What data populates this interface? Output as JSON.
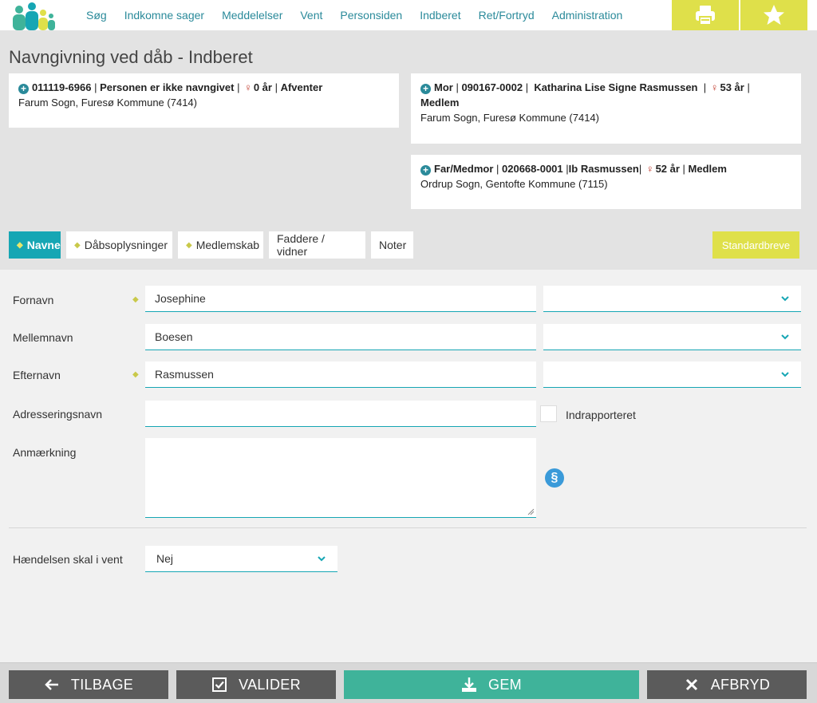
{
  "nav": {
    "items": [
      "Søg",
      "Indkomne sager",
      "Meddelelser",
      "Vent",
      "Personsiden",
      "Indberet",
      "Ret/Fortryd",
      "Administration"
    ]
  },
  "page": {
    "title": "Navngivning ved dåb - Indberet"
  },
  "child": {
    "cpr": "011119-6966",
    "status": "Personen er ikke navngivet",
    "age": "0 år",
    "state": "Afventer",
    "parish": "Farum Sogn, Furesø Kommune (7414)"
  },
  "mother": {
    "role": "Mor",
    "cpr": "090167-0002",
    "name": "Katharina Lise Signe Rasmussen",
    "age": "53 år",
    "membership": "Medlem",
    "parish": "Farum Sogn, Furesø Kommune (7414)"
  },
  "father": {
    "role": "Far/Medmor",
    "cpr": "020668-0001",
    "name": "Ib Rasmussen",
    "age": "52 år",
    "membership": "Medlem",
    "parish": "Ordrup Sogn, Gentofte Kommune (7115)"
  },
  "tabs": [
    {
      "label": "Navne",
      "dot": true,
      "active": true
    },
    {
      "label": "Dåbsoplysninger",
      "dot": true
    },
    {
      "label": "Medlemskab",
      "dot": true
    },
    {
      "label": "Faddere / vidner",
      "dot": false
    },
    {
      "label": "Noter",
      "dot": false
    }
  ],
  "standardbreve_label": "Standardbreve",
  "form": {
    "fornavn": {
      "label": "Fornavn",
      "value": "Josephine"
    },
    "mellemnavn": {
      "label": "Mellemnavn",
      "value": "Boesen"
    },
    "efternavn": {
      "label": "Efternavn",
      "value": "Rasmussen"
    },
    "adresseringsnavn": {
      "label": "Adresseringsnavn",
      "value": ""
    },
    "indrapporteret_label": "Indrapporteret",
    "anmaerkning": {
      "label": "Anmærkning",
      "value": ""
    },
    "paragraph_symbol": "§",
    "vent": {
      "label": "Hændelsen skal i vent",
      "value": "Nej"
    }
  },
  "footer": {
    "back": "TILBAGE",
    "validate": "VALIDER",
    "save": "GEM",
    "cancel": "AFBRYD"
  },
  "colors": {
    "accent": "#16a6b4",
    "yellow": "#dfe04a",
    "save": "#3fb39a",
    "dark_button": "#5b5b5b"
  }
}
